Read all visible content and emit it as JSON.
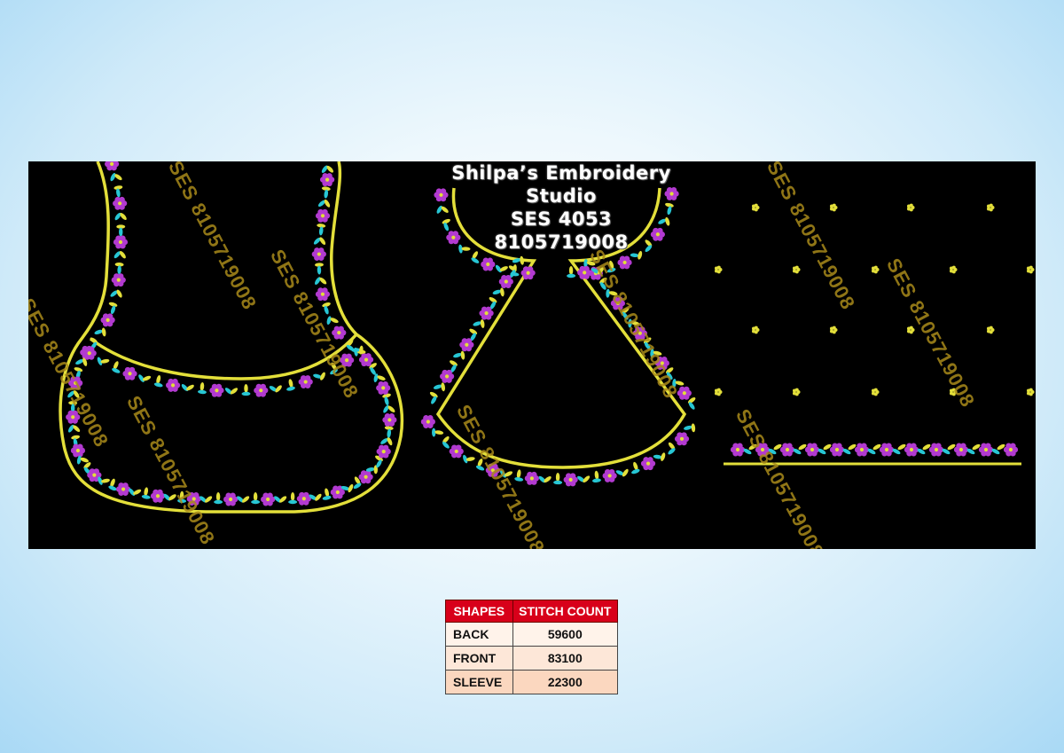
{
  "studio": {
    "name": "Shilpa’s Embroidery Studio",
    "code": "SES 4053",
    "phone": "8105719008"
  },
  "watermark_text": "SES 8105719008",
  "colors": {
    "gold": "#e3df3a",
    "magenta": "#b23ad0",
    "cyan": "#27c6d4",
    "table_header": "#d8001a"
  },
  "table": {
    "headers": [
      "SHAPES",
      "STITCH COUNT"
    ],
    "rows": [
      {
        "shape": "BACK",
        "count": "59600"
      },
      {
        "shape": "FRONT",
        "count": "83100"
      },
      {
        "shape": "SLEEVE",
        "count": "22300"
      }
    ]
  }
}
